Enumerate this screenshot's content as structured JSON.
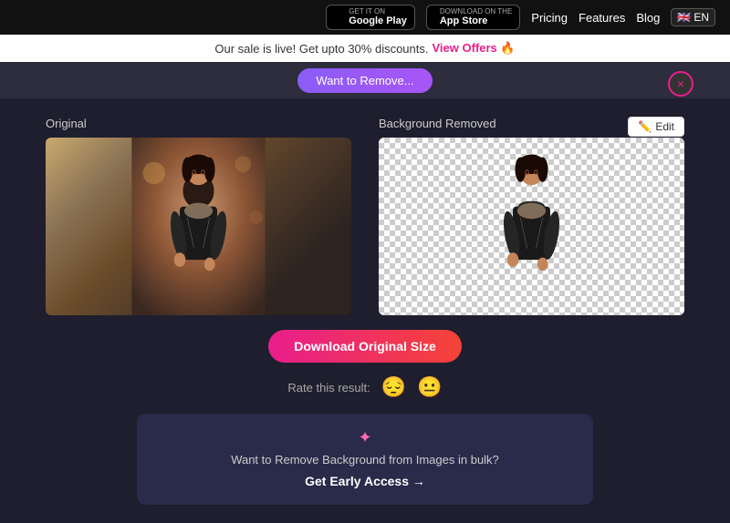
{
  "navbar": {
    "google_play_top": "GET IT ON",
    "google_play_bottom": "Google Play",
    "app_store_top": "Download on the",
    "app_store_bottom": "App Store",
    "pricing_label": "Pricing",
    "features_label": "Features",
    "blog_label": "Blog",
    "flag_label": "EN"
  },
  "sale_banner": {
    "text": "Our sale is live! Get upto 30% discounts.",
    "link_text": "View Offers",
    "link_icon": "🏷️"
  },
  "upload_bar": {
    "text": "Want to Remove..."
  },
  "panels": {
    "original_label": "Original",
    "removed_label": "Background Removed",
    "edit_button": "Edit"
  },
  "download": {
    "button_label": "Download Original Size"
  },
  "rating": {
    "label": "Rate this result:",
    "emoji1": "😔",
    "emoji2": "😐"
  },
  "bulk_cta": {
    "icon": "✦",
    "text": "Want to Remove Background from Images in bulk?",
    "link_text": "Get Early Access",
    "link_arrow": "→"
  },
  "close": {
    "symbol": "×"
  }
}
